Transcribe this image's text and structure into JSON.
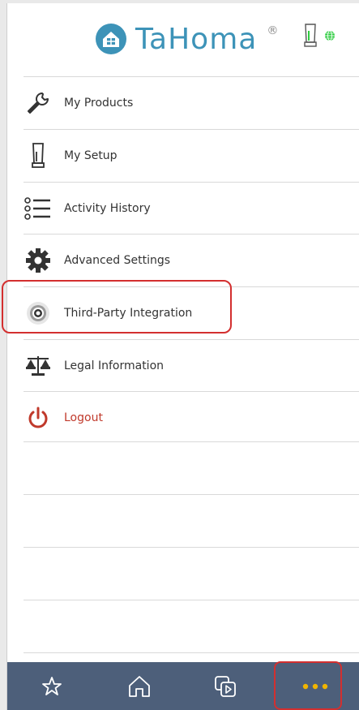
{
  "header": {
    "brand": "TaHoma",
    "reg_mark": "®",
    "brand_color": "#3d93b8",
    "icons": [
      "home-icon",
      "gateway-status-icon",
      "globe-icon"
    ]
  },
  "menu": {
    "items": [
      {
        "label": "My Products",
        "icon": "wrench-icon"
      },
      {
        "label": "My Setup",
        "icon": "gateway-icon"
      },
      {
        "label": "Activity History",
        "icon": "list-icon"
      },
      {
        "label": "Advanced Settings",
        "icon": "gear-icon"
      },
      {
        "label": "Third-Party Integration",
        "icon": "target-icon"
      },
      {
        "label": "Legal Information",
        "icon": "scales-icon"
      },
      {
        "label": "Logout",
        "icon": "power-icon"
      }
    ],
    "logout_color": "#c0392b"
  },
  "bottom_nav": {
    "items": [
      "favorites-icon",
      "home-icon",
      "scenarios-icon",
      "more-icon"
    ],
    "active": "more-icon",
    "active_color": "#f0b400",
    "background": "#4d5f7a"
  }
}
